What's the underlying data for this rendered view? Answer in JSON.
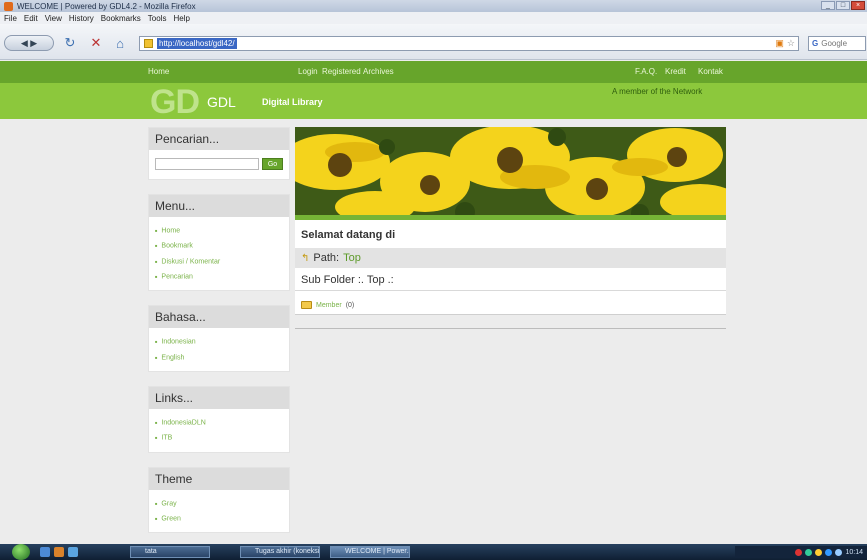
{
  "browser": {
    "title": "WELCOME | Powered by GDL4.2 - Mozilla Firefox",
    "menu": [
      "File",
      "Edit",
      "View",
      "History",
      "Bookmarks",
      "Tools",
      "Help"
    ],
    "url": "http://localhost/gdl42/",
    "search_placeholder": "Google"
  },
  "site": {
    "topnav": {
      "home": "Home",
      "login": "Login",
      "registered": "Registered",
      "archives": "Archives",
      "faq": "F.A.Q.",
      "kredit": "Kredit",
      "kontak": "Kontak"
    },
    "logo_big": "GD",
    "logo_small": "GDL",
    "logo_tag": "Digital Library",
    "member_text": "A member of the Network"
  },
  "sidebar": {
    "search": {
      "title": "Pencarian...",
      "button": "Go"
    },
    "menu": {
      "title": "Menu...",
      "items": [
        "Home",
        "Bookmark",
        "Diskusi / Komentar",
        "Pencarian"
      ]
    },
    "bahasa": {
      "title": "Bahasa...",
      "items": [
        "Indonesian",
        "English"
      ]
    },
    "links": {
      "title": "Links...",
      "items": [
        "IndonesiaDLN",
        "ITB"
      ]
    },
    "theme": {
      "title": "Theme",
      "items": [
        "Gray",
        "Green"
      ]
    }
  },
  "main": {
    "welcome": "Selamat datang di",
    "path_label": "Path:",
    "path_value": "Top",
    "subfolder": "Sub Folder :. Top .:",
    "folder_link": "Member",
    "folder_count": "(0)"
  },
  "taskbar": {
    "tasks": [
      "tata",
      "Tugas akhir (koneksi...",
      "WELCOME | Power..."
    ],
    "clock": "10:14"
  },
  "colors": {
    "nav_green": "#67a52b",
    "banner_green": "#8cc83c",
    "link_green": "#7bb34a"
  }
}
